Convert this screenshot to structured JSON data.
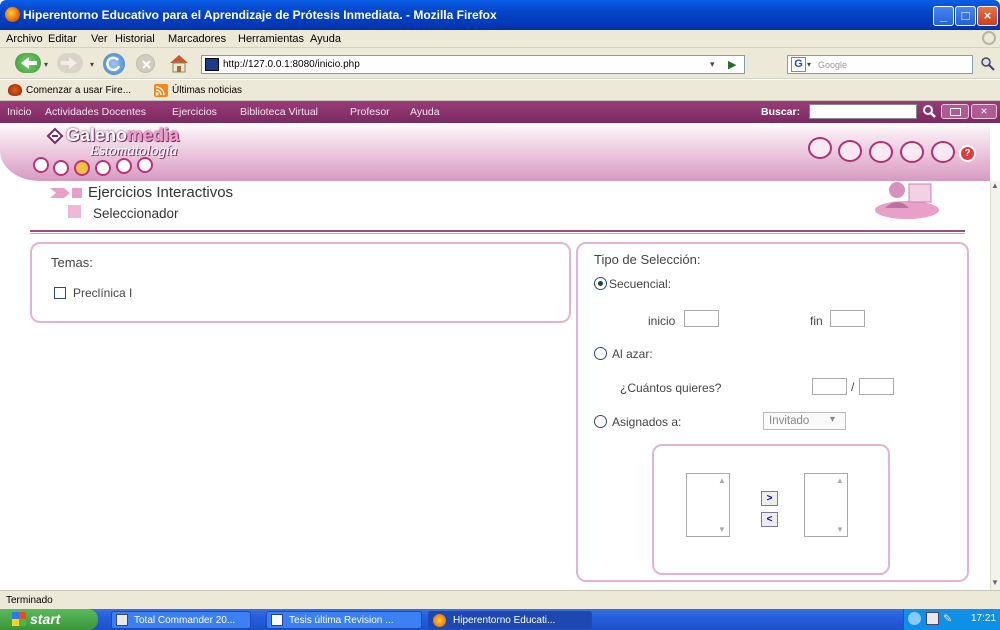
{
  "window": {
    "title": "Hiperentorno Educativo para el Aprendizaje de Prótesis Inmediata. - Mozilla Firefox"
  },
  "menubar": {
    "items": [
      "Archivo",
      "Editar",
      "Ver",
      "Historial",
      "Marcadores",
      "Herramientas",
      "Ayuda"
    ]
  },
  "navbar": {
    "url": "http://127.0.0.1:8080/inicio.php",
    "search_placeholder": "Google",
    "search_engine_icon": "google-icon"
  },
  "bookmarks": {
    "items": [
      "Comenzar a usar Fire...",
      "Últimas noticias"
    ]
  },
  "appnav": {
    "items": [
      "Inicio",
      "Actividades Docentes",
      "Ejercicios",
      "Biblioteca Virtual",
      "Profesor",
      "Ayuda"
    ],
    "search_label": "Buscar:"
  },
  "header": {
    "logo_main": "Galeno",
    "logo_accent": "media",
    "logo_sub": "Estomatología"
  },
  "page": {
    "section_title": "Ejercicios Interactivos",
    "subsection_title": "Seleccionador"
  },
  "temas": {
    "heading": "Temas:",
    "items": [
      {
        "label": "Preclínica I",
        "checked": false
      }
    ]
  },
  "seleccion": {
    "heading": "Tipo de Selección:",
    "secuencial_label": "Secuencial:",
    "secuencial_selected": true,
    "inicio_label": "inicio",
    "inicio_value": "",
    "fin_label": "fin",
    "fin_value": "",
    "azar_label": "Al azar:",
    "azar_selected": false,
    "cuantos_label": "¿Cuántos quieres?",
    "cuantos_sep": "/",
    "asignados_label": "Asignados a:",
    "asignados_selected": false,
    "asignados_value": "Invitado",
    "move_right": ">",
    "move_left": "<"
  },
  "status": {
    "text": "Terminado"
  },
  "taskbar": {
    "start": "start",
    "tasks": [
      "Total Commander 20...",
      "Tesis última Revision ...",
      "Hiperentorno Educati..."
    ],
    "active_task": 2,
    "clock": "17:21"
  },
  "colors": {
    "brand": "#7a2a60",
    "panel_border": "#e4b4cf",
    "accent_pink": "#e8a0c8"
  }
}
